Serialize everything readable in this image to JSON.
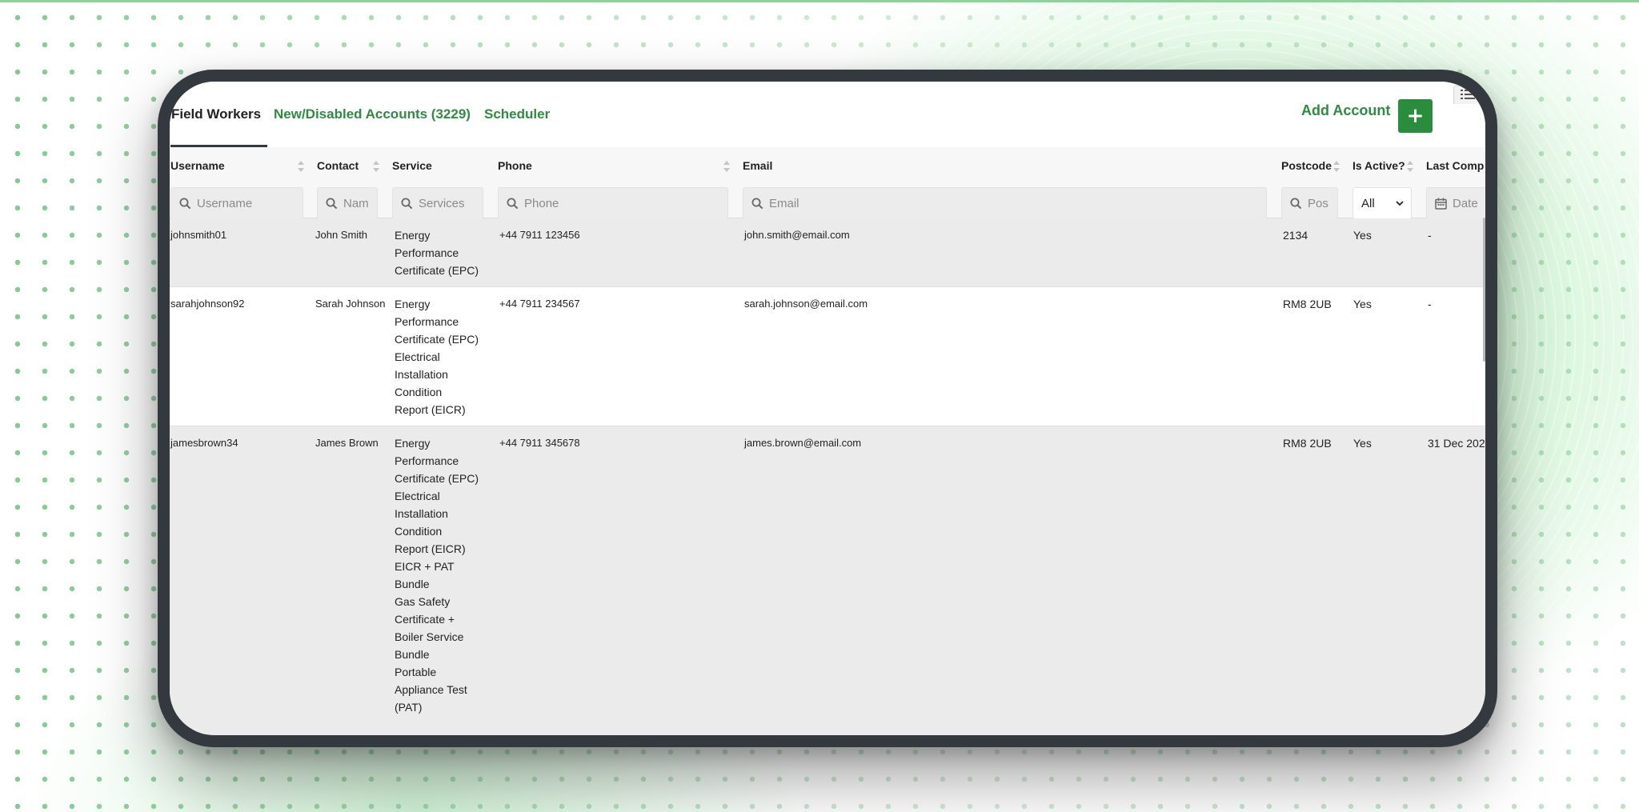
{
  "tabs": {
    "active": "Field Workers",
    "new_disabled": "New/Disabled Accounts (3229)",
    "scheduler": "Scheduler"
  },
  "actions": {
    "add_account_label": "Add Account",
    "add_button_glyph": "+"
  },
  "columns": {
    "username": "Username",
    "contact": "Contact",
    "service": "Service",
    "phone": "Phone",
    "email": "Email",
    "postcode": "Postcode",
    "is_active": "Is Active?",
    "last_completed": "Last Comp"
  },
  "filters": {
    "username_placeholder": "Username",
    "contact_placeholder": "Nam",
    "service_placeholder": "Services",
    "phone_placeholder": "Phone",
    "email_placeholder": "Email",
    "postcode_placeholder": "Pos",
    "active_value": "All",
    "date_placeholder": "Date"
  },
  "rows": [
    {
      "username": "johnsmith01",
      "contact": "John Smith",
      "services": [
        "Energy",
        "Performance",
        "Certificate (EPC)"
      ],
      "phone": "+44 7911 123456",
      "email": "john.smith@email.com",
      "postcode": "2134",
      "active": "Yes",
      "last": "-"
    },
    {
      "username": "sarahjohnson92",
      "contact": "Sarah Johnson",
      "services": [
        "Energy",
        "Performance",
        "Certificate (EPC)",
        "Electrical",
        "Installation",
        "Condition",
        "Report (EICR)"
      ],
      "phone": "+44 7911 234567",
      "email": "sarah.johnson@email.com",
      "postcode": "RM8 2UB",
      "active": "Yes",
      "last": "-"
    },
    {
      "username": "jamesbrown34",
      "contact": "James Brown",
      "services": [
        "Energy",
        "Performance",
        "Certificate (EPC)",
        "Electrical",
        "Installation",
        "Condition",
        "Report (EICR)",
        "EICR + PAT",
        "Bundle",
        "Gas Safety",
        "Certificate +",
        "Boiler Service",
        "Bundle",
        "Portable",
        "Appliance Test",
        "(PAT)"
      ],
      "phone": "+44 7911 345678",
      "email": "james.brown@email.com",
      "postcode": "RM8 2UB",
      "active": "Yes",
      "last": "31 Dec 202"
    }
  ],
  "colors": {
    "accent_green": "#2e8b3f",
    "button_green": "#2a8d3e",
    "device_frame": "#34383f",
    "row_alt": "#ebebeb"
  },
  "icons": [
    "search-icon",
    "calendar-icon",
    "chevron-down-icon",
    "plus-icon",
    "sort-icon",
    "column-list-icon"
  ]
}
